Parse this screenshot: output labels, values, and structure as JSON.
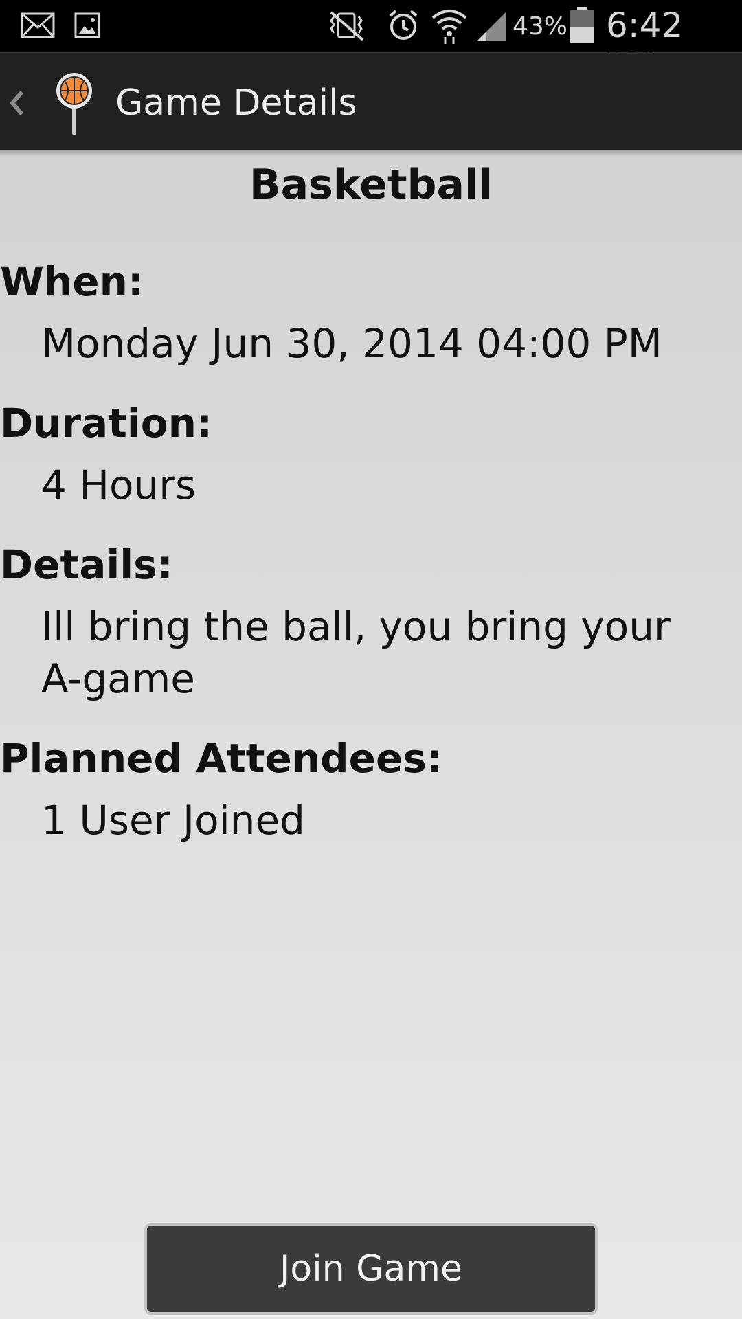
{
  "status_bar": {
    "icons": [
      "mail-icon",
      "image-icon",
      "vibrate-icon",
      "alarm-icon",
      "wifi-icon",
      "signal-icon",
      "battery-icon"
    ],
    "battery_percent": "43%",
    "time": "6:42 PM"
  },
  "action_bar": {
    "title": "Game Details",
    "logo": "basketball-pin-icon",
    "back": "chevron-left-icon"
  },
  "game": {
    "sport": "Basketball",
    "when_label": "When:",
    "when_value": "Monday Jun 30, 2014 04:00 PM",
    "duration_label": "Duration:",
    "duration_value": "4 Hours",
    "details_label": "Details:",
    "details_value": "Ill bring the ball, you bring your A-game",
    "attendees_label": "Planned Attendees:",
    "attendees_value": "1 User Joined"
  },
  "actions": {
    "join_label": "Join Game"
  },
  "colors": {
    "status_bar_bg": "#000000",
    "action_bar_bg": "#212121",
    "button_bg": "#3b3b3b",
    "logo_orange": "#f08a3c"
  }
}
